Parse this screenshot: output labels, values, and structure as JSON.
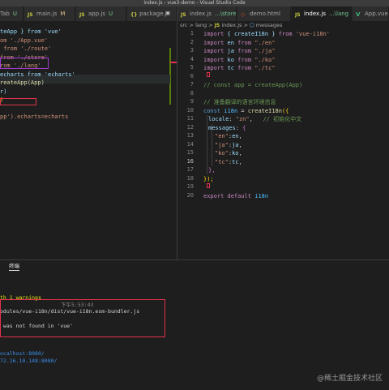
{
  "window_title": "index.js - vue3-demo - Visual Studio Code",
  "tabs_left": [
    {
      "label": "Tab",
      "suffix": "U",
      "type": "vue"
    },
    {
      "label": "main.js",
      "suffix": "M",
      "type": "js"
    },
    {
      "label": "app.js",
      "suffix": "U",
      "type": "js"
    },
    {
      "label": "package.j",
      "suffix": "",
      "type": "json"
    }
  ],
  "tabs_right": [
    {
      "label": "index.js",
      "suffix": "...\\store U",
      "type": "js"
    },
    {
      "label": "demo.html",
      "suffix": "",
      "type": "html"
    },
    {
      "label": "index.js",
      "suffix": "...\\lang U",
      "type": "js"
    },
    {
      "label": "App.vue",
      "suffix": "",
      "type": "vue"
    }
  ],
  "breadcrumb": {
    "path": "src > lang > ",
    "file": "index.js",
    "sep": " > ",
    "symbol": "messages"
  },
  "left_code": [
    "teApp } from 'vue'",
    "om './App.vue'",
    " from './route'",
    "from './store'",
    "rom './lang'",
    "echarts from 'echarts'",
    "reateApp(App)",
    "r)",
    ")",
    "",
    "pp').echarts=echarts"
  ],
  "right_code": {
    "line_numbers": [
      "1",
      "2",
      "3",
      "4",
      "5",
      "6",
      "7",
      "8",
      "9",
      "10",
      "11",
      "12",
      "13",
      "14",
      "15",
      "16",
      "17",
      "18",
      "19",
      "20"
    ],
    "l1_import": "import",
    "l1_brace": "{ createI18n }",
    "l1_from": "from",
    "l1_src": "'vue-i18n'",
    "l2_name": "en",
    "l2_src": "\"./en\"",
    "l3_name": "ja",
    "l3_src": "\"./ja\"",
    "l4_name": "ko",
    "l4_src": "\"./ko\"",
    "l5_name": "tc",
    "l5_src": "\"./tc\"",
    "l7_comment": "// const app = createApp(App)",
    "l9_comment": "// 准备翻译的语言环境信息",
    "l10_const": "const",
    "l10_var": "i18n",
    "l10_eq": " = ",
    "l10_fn": "createI18n",
    "l10_open": "({",
    "l11_key": "locale",
    "l11_val": "\"zn\"",
    "l11_comment": "// 初始化中文",
    "l12_key": "messages",
    "l13_key": "\"en\"",
    "l13_val": "en",
    "l14_key": "\"ja\"",
    "l14_val": "ja",
    "l15_key": "\"ko\"",
    "l15_val": "ko",
    "l16_key": "\"tc\"",
    "l16_val": "tc",
    "l17_close": "},",
    "l18_close": "});",
    "l20_export": "export default",
    "l20_var": "i18n"
  },
  "panel": {
    "tab_label": "终端",
    "lines": {
      "warnings": "th 1 warnings",
      "time": "下午5:53:43",
      "bundle": "odules/vue-i18n/dist/vue-i18n.esm-bundler.js",
      "notfound": " was not found in 'vue'",
      "local": "ocalhost:8080/",
      "network": "72.16.10.148:8080/"
    }
  },
  "watermark": "@稀土掘金技术社区",
  "colors": {
    "keyword": "#c586c0",
    "string": "#ce9178",
    "variable": "#9cdcfe",
    "function": "#dcdcaa",
    "comment": "#6a9955",
    "annotation_red": "#e0324b",
    "annotation_purple": "#a33bd0"
  }
}
